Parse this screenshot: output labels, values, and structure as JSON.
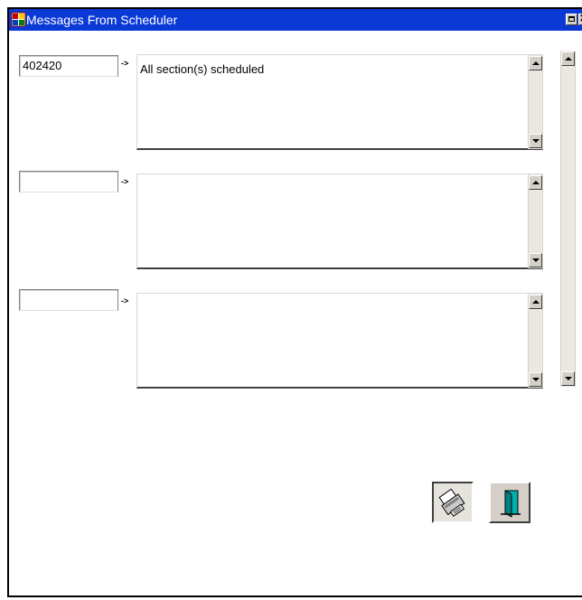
{
  "window": {
    "title": "Messages From Scheduler",
    "title_bar_color": "#0a39d6"
  },
  "rows": [
    {
      "code": "402420",
      "arrow": "->",
      "message": "All section(s) scheduled"
    },
    {
      "code": "",
      "arrow": "->",
      "message": ""
    },
    {
      "code": "",
      "arrow": "->",
      "message": ""
    }
  ],
  "toolbar": {
    "print_icon": "printer-icon",
    "exit_icon": "exit-door-icon"
  }
}
